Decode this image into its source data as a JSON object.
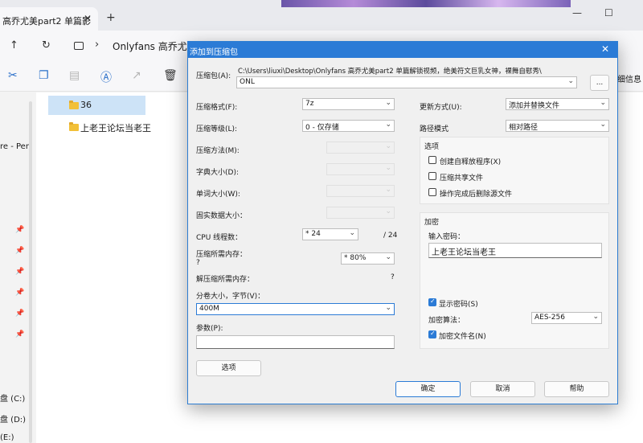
{
  "explorer": {
    "tab_title": "高乔尤美part2 单篇影",
    "tab_close": "✕",
    "new_tab": "+",
    "win_min": "—",
    "win_max": "☐",
    "nav_up": "↑",
    "nav_refresh": "↻",
    "crumb_sep": "›",
    "crumb": "Onlyfans 高乔尤美",
    "details_label": "细信息",
    "sidebar_texts": [
      "re - Per",
      "盘 (C:)",
      "盘 (D:)",
      "(E:)"
    ],
    "pin": "📌",
    "files": [
      {
        "name": "36"
      },
      {
        "name": "上老王论坛当老王"
      }
    ]
  },
  "dialog": {
    "title": "添加到压缩包",
    "close": "✕",
    "archive_label": "压缩包(A):",
    "archive_path": "C:\\Users\\liuxi\\Desktop\\Onlyfans 高乔尤美part2 单篇解锁视频，绝美符文巨乳女神，裸舞自慰秀\\",
    "archive_name": "ONL",
    "browse_label": "...",
    "format_label": "压缩格式(F):",
    "format_value": "7z",
    "level_label": "压缩等级(L):",
    "level_value": "0 - 仅存储",
    "method_label": "压缩方法(M):",
    "dict_label": "字典大小(D):",
    "word_label": "单词大小(W):",
    "solid_label": "固实数据大小：",
    "threads_label": "CPU 线程数：",
    "threads_value": "* 24",
    "threads_max": "/ 24",
    "mem_comp_label": "压缩所需内存：",
    "mem_comp_q": "?",
    "mem_value": "* 80%",
    "mem_decomp_label": "解压缩所需内存：",
    "mem_decomp_q": "?",
    "volume_label": "分卷大小，字节(V)：",
    "volume_value": "400M",
    "params_label": "参数(P):",
    "params_value": "",
    "options_button": "选项",
    "update_label": "更新方式(U):",
    "update_value": "添加并替换文件",
    "path_label": "路径模式",
    "path_value": "相对路径",
    "options_group": "选项",
    "opt_sfx": "创建自释放程序(X)",
    "opt_shared": "压缩共享文件",
    "opt_delete": "操作完成后删除源文件",
    "encrypt_group": "加密",
    "password_label": "输入密码：",
    "password_value": "上老王论坛当老王",
    "show_password": "显示密码(S)",
    "enc_method_label": "加密算法：",
    "enc_method_value": "AES-256",
    "encrypt_names": "加密文件名(N)",
    "ok_button": "确定",
    "cancel_button": "取消",
    "help_button": "帮助",
    "arrow": "⌄"
  }
}
